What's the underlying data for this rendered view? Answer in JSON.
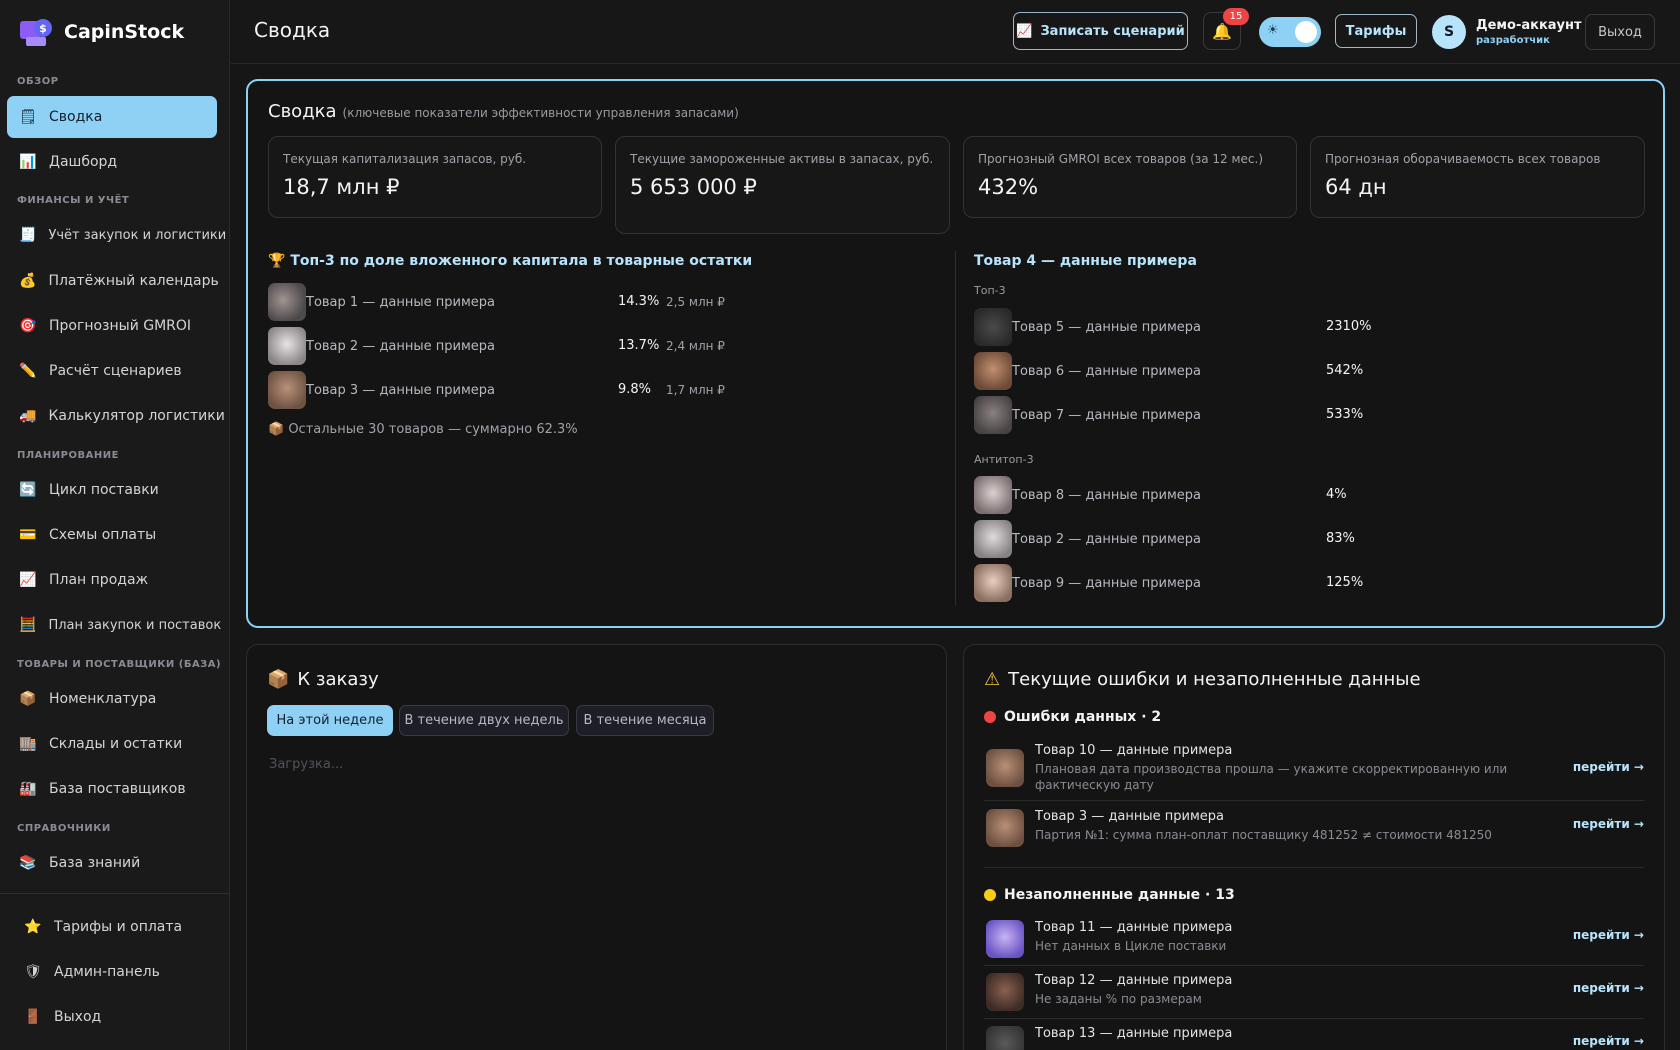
{
  "app": {
    "name": "CapinStock"
  },
  "sidebar": {
    "sections": [
      "ОБЗОР",
      "ФИНАНСЫ И УЧЁТ",
      "ПЛАНИРОВАНИЕ",
      "ТОВАРЫ И ПОСТАВЩИКИ (БАЗА)",
      "СПРАВОЧНИКИ"
    ],
    "items": [
      {
        "label": "Сводка",
        "icon": "summary-icon",
        "active": true
      },
      {
        "label": "Дашборд",
        "icon": "bar-chart-icon"
      },
      {
        "label": "Учёт закупок и логистики",
        "icon": "receipt-icon"
      },
      {
        "label": "Платёжный календарь",
        "icon": "money-bag-icon"
      },
      {
        "label": "Прогнозный GMROI",
        "icon": "target-icon"
      },
      {
        "label": "Расчёт сценариев",
        "icon": "pencil-icon"
      },
      {
        "label": "Калькулятор логистики",
        "icon": "truck-icon"
      },
      {
        "label": "Цикл поставки",
        "icon": "cycle-icon"
      },
      {
        "label": "Схемы оплаты",
        "icon": "card-icon"
      },
      {
        "label": "План продаж",
        "icon": "trend-icon"
      },
      {
        "label": "План закупок и поставок",
        "icon": "calendar-icon"
      },
      {
        "label": "Номенклатура",
        "icon": "box-icon"
      },
      {
        "label": "Склады и остатки",
        "icon": "warehouse-icon"
      },
      {
        "label": "База поставщиков",
        "icon": "factory-icon"
      },
      {
        "label": "База знаний",
        "icon": "books-icon"
      }
    ],
    "bottom": [
      {
        "label": "Тарифы и оплата",
        "icon": "star-icon"
      },
      {
        "label": "Админ-панель",
        "icon": "shield-icon"
      },
      {
        "label": "Выход",
        "icon": "door-icon"
      }
    ]
  },
  "topbar": {
    "title": "Сводка",
    "record_label": "Записать сценарий",
    "notif_count": "15",
    "tariffs_label": "Тарифы",
    "avatar_initial": "S",
    "user_name": "Демо-аккаунт",
    "user_role": "разработчик",
    "logout_label": "Выход",
    "accent": "#8fd0f5"
  },
  "summary": {
    "title": "Сводка",
    "subtitle": "(ключевые показатели эффективности управления запасами)",
    "kpis": [
      {
        "label": "Текущая капитализация запасов, руб.",
        "value": "18,7 млн ₽"
      },
      {
        "label": "Текущие замороженные активы в запасах, руб.",
        "value": "5 653 000 ₽"
      },
      {
        "label": "Прогнозный GMROI всех товаров (за 12 мес.)",
        "value": "432%"
      },
      {
        "label": "Прогнозная оборачиваемость всех товаров",
        "value": "64 дн"
      }
    ],
    "top3": {
      "title": "Топ-3 по доле вложенного капитала в товарные остатки",
      "items": [
        {
          "name": "Товар 1 — данные примера",
          "share": "14.3%",
          "amount": "2,5 млн ₽"
        },
        {
          "name": "Товар 2 — данные примера",
          "share": "13.7%",
          "amount": "2,4 млн ₽"
        },
        {
          "name": "Товар 3 — данные примера",
          "share": "9.8%",
          "amount": "1,7 млн ₽"
        }
      ],
      "rest": "Остальные 30 товаров — суммарно 62.3%"
    },
    "right": {
      "title": "Товар 4 — данные примера",
      "top_label": "Топ-3",
      "top": [
        {
          "name": "Товар 5 — данные примера",
          "value": "2310%"
        },
        {
          "name": "Товар 6 — данные примера",
          "value": "542%"
        },
        {
          "name": "Товар 7 — данные примера",
          "value": "533%"
        }
      ],
      "anti_label": "Антитоп-3",
      "anti": [
        {
          "name": "Товар 8 — данные примера",
          "value": "4%"
        },
        {
          "name": "Товар 2 — данные примера",
          "value": "83%"
        },
        {
          "name": "Товар 9 — данные примера",
          "value": "125%"
        }
      ]
    }
  },
  "order": {
    "title": "К заказу",
    "tabs": [
      "На этой неделе",
      "В течение двух недель",
      "В течение месяца"
    ],
    "loading": "Загрузка..."
  },
  "errors": {
    "title": "Текущие ошибки и незаполненные данные",
    "data_errors_label": "Ошибки данных · 2",
    "missing_label": "Незаполненные данные · 13",
    "go_label": "перейти →",
    "error_items": [
      {
        "name": "Товар 10 — данные примера",
        "desc": "Плановая дата производства прошла — укажите скорректированную или фактическую дату"
      },
      {
        "name": "Товар 3 — данные примера",
        "desc": "Партия №1: сумма план-оплат поставщику 481252 ≠ стоимости 481250"
      }
    ],
    "missing_items": [
      {
        "name": "Товар 11 — данные примера",
        "desc": "Нет данных в Цикле поставки"
      },
      {
        "name": "Товар 12 — данные примера",
        "desc": "Не заданы % по размерам"
      },
      {
        "name": "Товар 13 — данные примера",
        "desc": ""
      }
    ]
  }
}
